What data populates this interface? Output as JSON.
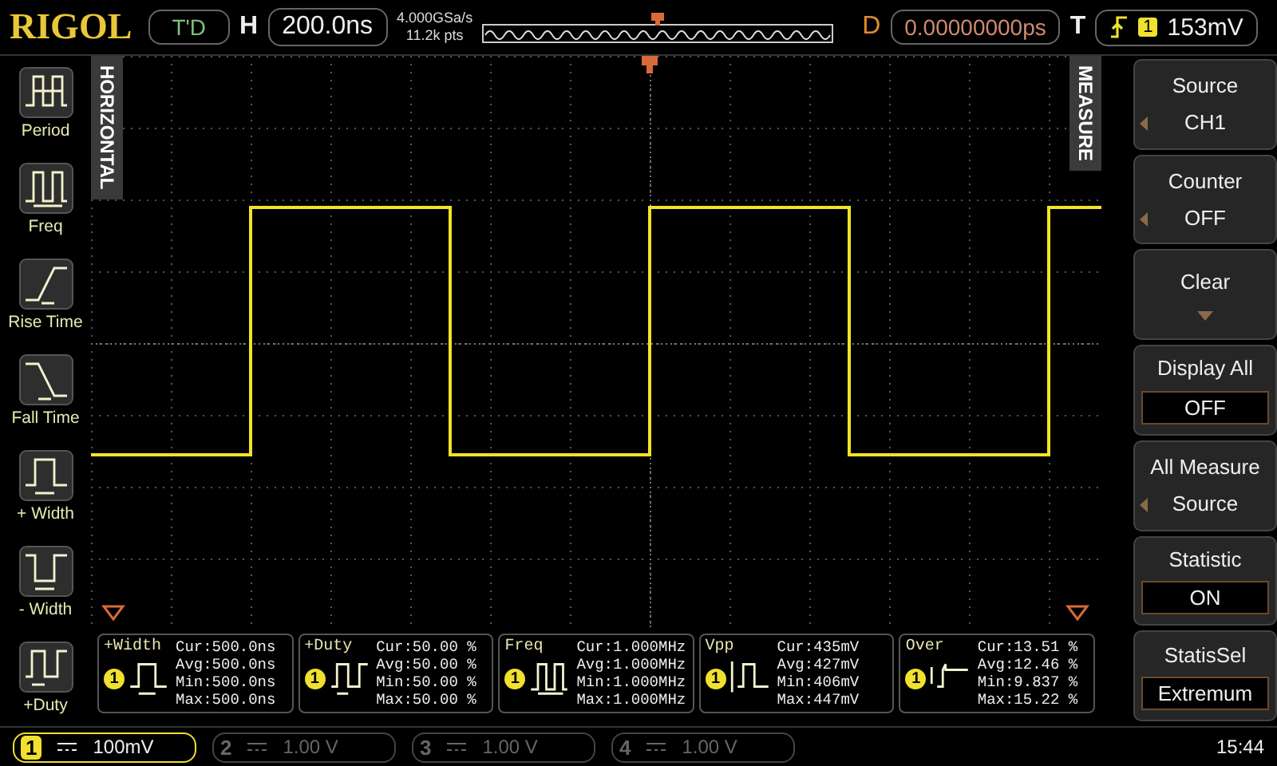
{
  "top_bar": {
    "logo": "RIGOL",
    "run_status": "T'D",
    "horizontal_label": "H",
    "timebase": "200.0ns",
    "sample_rate": "4.000GSa/s",
    "memory_depth": "11.2k pts",
    "delay_label": "D",
    "delay": "0.00000000ps",
    "trigger_label": "T",
    "trigger_source": "1",
    "trigger_level": "153mV"
  },
  "left_menu": {
    "tab": "HORIZONTAL",
    "items": [
      {
        "kind": "period",
        "label": "Period"
      },
      {
        "kind": "freq",
        "label": "Freq"
      },
      {
        "kind": "rise",
        "label": "Rise Time"
      },
      {
        "kind": "fall",
        "label": "Fall Time"
      },
      {
        "kind": "pwidth",
        "label": "+ Width"
      },
      {
        "kind": "nwidth",
        "label": "- Width"
      },
      {
        "kind": "pduty",
        "label": "+Duty"
      }
    ]
  },
  "right_menu": {
    "tab": "MEASURE",
    "items": [
      {
        "kind": "select",
        "title": "Source",
        "value": "CH1"
      },
      {
        "kind": "select",
        "title": "Counter",
        "value": "OFF"
      },
      {
        "kind": "action",
        "title": "Clear"
      },
      {
        "kind": "toggle",
        "title": "Display All",
        "value": "OFF"
      },
      {
        "kind": "select",
        "title": "All Measure",
        "value": "Source"
      },
      {
        "kind": "toggle",
        "title": "Statistic",
        "value": "ON"
      },
      {
        "kind": "toggle",
        "title": "StatisSel",
        "value": "Extremum"
      }
    ]
  },
  "measurements": [
    {
      "kind": "pwidth",
      "label": "+Width",
      "source": "1",
      "lines": [
        "Cur:500.0ns",
        "Avg:500.0ns",
        "Min:500.0ns",
        "Max:500.0ns"
      ]
    },
    {
      "kind": "pduty",
      "label": "+Duty",
      "source": "1",
      "lines": [
        "Cur:50.00 %",
        "Avg:50.00 %",
        "Min:50.00 %",
        "Max:50.00 %"
      ]
    },
    {
      "kind": "freq",
      "label": "Freq",
      "source": "1",
      "lines": [
        "Cur:1.000MHz",
        "Avg:1.000MHz",
        "Min:1.000MHz",
        "Max:1.000MHz"
      ]
    },
    {
      "kind": "vpp",
      "label": "Vpp",
      "source": "1",
      "lines": [
        "Cur:435mV",
        "Avg:427mV",
        "Min:406mV",
        "Max:447mV"
      ]
    },
    {
      "kind": "over",
      "label": "Over",
      "source": "1",
      "lines": [
        "Cur:13.51 %",
        "Avg:12.46 %",
        "Min:9.837 %",
        "Max:15.22 %"
      ]
    }
  ],
  "channels": [
    {
      "number": "1",
      "scale": "100mV",
      "on": true
    },
    {
      "number": "2",
      "scale": "1.00 V",
      "on": false
    },
    {
      "number": "3",
      "scale": "1.00 V",
      "on": false
    },
    {
      "number": "4",
      "scale": "1.00 V",
      "on": false
    }
  ],
  "clock": "15:44"
}
